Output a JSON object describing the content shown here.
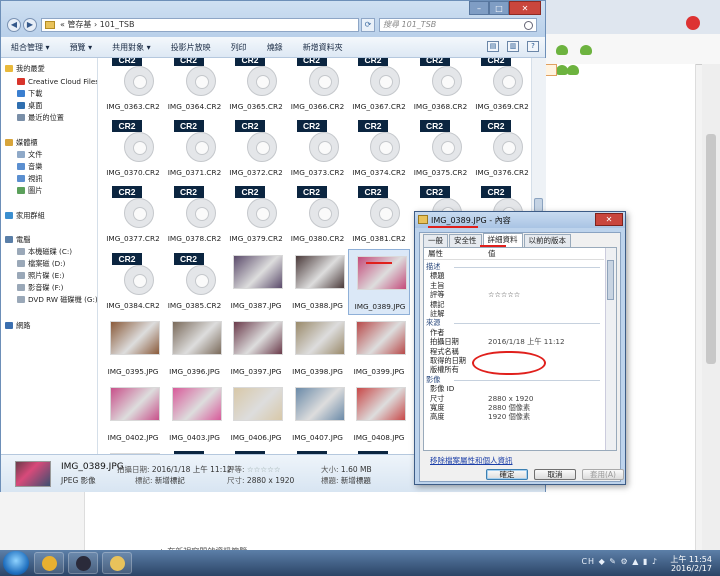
{
  "browser": {
    "tab_title": "",
    "footer_text": "+ 在新視窗開啟資訊簡覽"
  },
  "explorer": {
    "address": "« 管存基 › 101_TSB",
    "search_placeholder": "搜尋 101_TSB",
    "window_controls": {
      "minimize": "–",
      "maximize": "□",
      "close": "✕"
    },
    "commands": [
      "組合管理 ▾",
      "預覽 ▾",
      "共用對象 ▾",
      "投影片放映",
      "列印",
      "燒錄",
      "新增資料夾"
    ],
    "nav": [
      {
        "label": "我的最愛",
        "icon": "star-icon",
        "sub": false
      },
      {
        "label": "Creative Cloud Files",
        "icon": "cloud-icon",
        "sub": true
      },
      {
        "label": "下載",
        "icon": "download-icon",
        "sub": true
      },
      {
        "label": "桌面",
        "icon": "desktop-icon",
        "sub": true
      },
      {
        "label": "最近的位置",
        "icon": "recent-icon",
        "sub": true
      },
      {
        "label": "媒體櫃",
        "icon": "library-icon",
        "sub": false
      },
      {
        "label": "文件",
        "icon": "document-icon",
        "sub": true
      },
      {
        "label": "音樂",
        "icon": "music-icon",
        "sub": true
      },
      {
        "label": "視訊",
        "icon": "video-icon",
        "sub": true
      },
      {
        "label": "圖片",
        "icon": "picture-icon",
        "sub": true
      },
      {
        "label": "家用群組",
        "icon": "homegroup-icon",
        "sub": false
      },
      {
        "label": "電腦",
        "icon": "computer-icon",
        "sub": false
      },
      {
        "label": "本機磁碟 (C:)",
        "icon": "drive-icon",
        "sub": true
      },
      {
        "label": "檔案磁 (D:)",
        "icon": "drive-icon",
        "sub": true
      },
      {
        "label": "照片碟 (E:)",
        "icon": "drive-icon",
        "sub": true
      },
      {
        "label": "影音碟 (F:)",
        "icon": "drive-icon",
        "sub": true
      },
      {
        "label": "DVD RW 磁碟機 (G:)",
        "icon": "dvd-icon",
        "sub": true
      },
      {
        "label": "網路",
        "icon": "network-icon",
        "sub": false
      }
    ],
    "cr2_badge": "CR2",
    "files": [
      {
        "name": "IMG_0363.CR2",
        "kind": "cr2"
      },
      {
        "name": "IMG_0364.CR2",
        "kind": "cr2"
      },
      {
        "name": "IMG_0365.CR2",
        "kind": "cr2"
      },
      {
        "name": "IMG_0366.CR2",
        "kind": "cr2"
      },
      {
        "name": "IMG_0367.CR2",
        "kind": "cr2"
      },
      {
        "name": "IMG_0368.CR2",
        "kind": "cr2"
      },
      {
        "name": "IMG_0369.CR2",
        "kind": "cr2"
      },
      {
        "name": "IMG_0370.CR2",
        "kind": "cr2"
      },
      {
        "name": "IMG_0371.CR2",
        "kind": "cr2"
      },
      {
        "name": "IMG_0372.CR2",
        "kind": "cr2"
      },
      {
        "name": "IMG_0373.CR2",
        "kind": "cr2"
      },
      {
        "name": "IMG_0374.CR2",
        "kind": "cr2"
      },
      {
        "name": "IMG_0375.CR2",
        "kind": "cr2"
      },
      {
        "name": "IMG_0376.CR2",
        "kind": "cr2"
      },
      {
        "name": "IMG_0377.CR2",
        "kind": "cr2"
      },
      {
        "name": "IMG_0378.CR2",
        "kind": "cr2"
      },
      {
        "name": "IMG_0379.CR2",
        "kind": "cr2"
      },
      {
        "name": "IMG_0380.CR2",
        "kind": "cr2"
      },
      {
        "name": "IMG_0381.CR2",
        "kind": "cr2"
      },
      {
        "name": "IMG_0382.CR2",
        "kind": "cr2"
      },
      {
        "name": "IMG_0383.CR2",
        "kind": "cr2"
      },
      {
        "name": "IMG_0384.CR2",
        "kind": "cr2"
      },
      {
        "name": "IMG_0385.CR2",
        "kind": "cr2"
      },
      {
        "name": "IMG_0387.JPG",
        "kind": "jpg",
        "color": "#5a4a6a"
      },
      {
        "name": "IMG_0388.JPG",
        "kind": "jpg",
        "color": "#4a3a3a"
      },
      {
        "name": "IMG_0389.JPG",
        "kind": "jpg",
        "color": "#c44a7a",
        "selected": true
      },
      {
        "name": "",
        "kind": "none"
      },
      {
        "name": "",
        "kind": "none"
      },
      {
        "name": "IMG_0395.JPG",
        "kind": "jpg",
        "color": "#8a5a3a"
      },
      {
        "name": "IMG_0396.JPG",
        "kind": "jpg",
        "color": "#7a6a5a"
      },
      {
        "name": "IMG_0397.JPG",
        "kind": "jpg",
        "color": "#6a3a4a"
      },
      {
        "name": "IMG_0398.JPG",
        "kind": "jpg",
        "color": "#9a8a6a"
      },
      {
        "name": "IMG_0399.JPG",
        "kind": "jpg",
        "color": "#b84a4a"
      },
      {
        "name": "",
        "kind": "none"
      },
      {
        "name": "",
        "kind": "none"
      },
      {
        "name": "IMG_0402.JPG",
        "kind": "jpg",
        "color": "#c8508a"
      },
      {
        "name": "IMG_0403.JPG",
        "kind": "jpg",
        "color": "#d85a9a"
      },
      {
        "name": "IMG_0406.JPG",
        "kind": "jpg",
        "color": "#d8c8a8"
      },
      {
        "name": "IMG_0407.JPG",
        "kind": "jpg",
        "color": "#6a8aa8"
      },
      {
        "name": "IMG_0408.JPG",
        "kind": "jpg",
        "color": "#c84848"
      },
      {
        "name": "",
        "kind": "none"
      },
      {
        "name": "",
        "kind": "none"
      },
      {
        "name": "IMG_0411.JPG",
        "kind": "jpg",
        "color": "#b84878"
      },
      {
        "name": "IMG_0412.CR2",
        "kind": "cr2"
      },
      {
        "name": "IMG_0413.CR2",
        "kind": "cr2"
      },
      {
        "name": "IMG_0414.CR2",
        "kind": "cr2"
      },
      {
        "name": "IMG_0415.CR2",
        "kind": "cr2"
      },
      {
        "name": "",
        "kind": "none"
      },
      {
        "name": "",
        "kind": "none"
      },
      {
        "name": "",
        "kind": "cr2"
      },
      {
        "name": "",
        "kind": "cr2"
      },
      {
        "name": "",
        "kind": "cr2"
      },
      {
        "name": "",
        "kind": "cr2"
      },
      {
        "name": "",
        "kind": "cr2"
      },
      {
        "name": "",
        "kind": "none"
      },
      {
        "name": "",
        "kind": "none"
      }
    ],
    "details": {
      "filename": "IMG_0389.JPG",
      "type": "JPEG 影像",
      "date_label": "拍攝日期:",
      "date_value": "2016/1/18 上午 11:12",
      "tags_label": "標記:",
      "tags_value": "新增標記",
      "rating_label": "評等:",
      "rating_stars": "☆☆☆☆☆",
      "dims_label": "尺寸:",
      "dims_value": "2880 x 1920",
      "size_label": "大小:",
      "size_value": "1.60 MB",
      "title_label": "標題:",
      "title_value": "新增標題"
    }
  },
  "properties": {
    "title": "IMG_0389.JPG - 內容",
    "close": "✕",
    "tabs": [
      "一般",
      "安全性",
      "詳細資料",
      "以前的版本"
    ],
    "active_tab": 2,
    "col_property": "屬性",
    "col_value": "值",
    "rows": [
      {
        "k": "描述",
        "v": "",
        "section": true
      },
      {
        "k": "標題",
        "v": ""
      },
      {
        "k": "主旨",
        "v": ""
      },
      {
        "k": "評等",
        "v": "☆☆☆☆☆"
      },
      {
        "k": "標記",
        "v": ""
      },
      {
        "k": "註解",
        "v": ""
      },
      {
        "k": "來源",
        "v": "",
        "section": true
      },
      {
        "k": "作者",
        "v": ""
      },
      {
        "k": "拍攝日期",
        "v": "2016/1/18 上午 11:12"
      },
      {
        "k": "程式名稱",
        "v": ""
      },
      {
        "k": "取得的日期",
        "v": ""
      },
      {
        "k": "版權所有",
        "v": ""
      },
      {
        "k": "影像",
        "v": "",
        "section": true
      },
      {
        "k": "影像 ID",
        "v": ""
      },
      {
        "k": "尺寸",
        "v": "2880 x 1920"
      },
      {
        "k": "寬度",
        "v": "2880 個像素"
      },
      {
        "k": "高度",
        "v": "1920 個像素"
      }
    ],
    "remove_link": "移除檔案屬性和個人資訊",
    "buttons": {
      "ok": "確定",
      "cancel": "取消",
      "apply": "套用(A)"
    }
  },
  "taskbar": {
    "apps": [
      {
        "icon": "chrome-icon",
        "color": "#e8b030"
      },
      {
        "icon": "video-app-icon",
        "color": "#2a2a3a"
      },
      {
        "icon": "folder-icon",
        "color": "#e8c25b"
      }
    ],
    "tray": "CH ◆ ✎ ⚙ ▲ ▮ ♪",
    "time": "上午 11:54",
    "date": "2016/2/17"
  },
  "colors": {
    "annotation_red": "#e0201c",
    "cr2_badge_bg": "#0b2540",
    "selection": "#dbe8f7"
  }
}
